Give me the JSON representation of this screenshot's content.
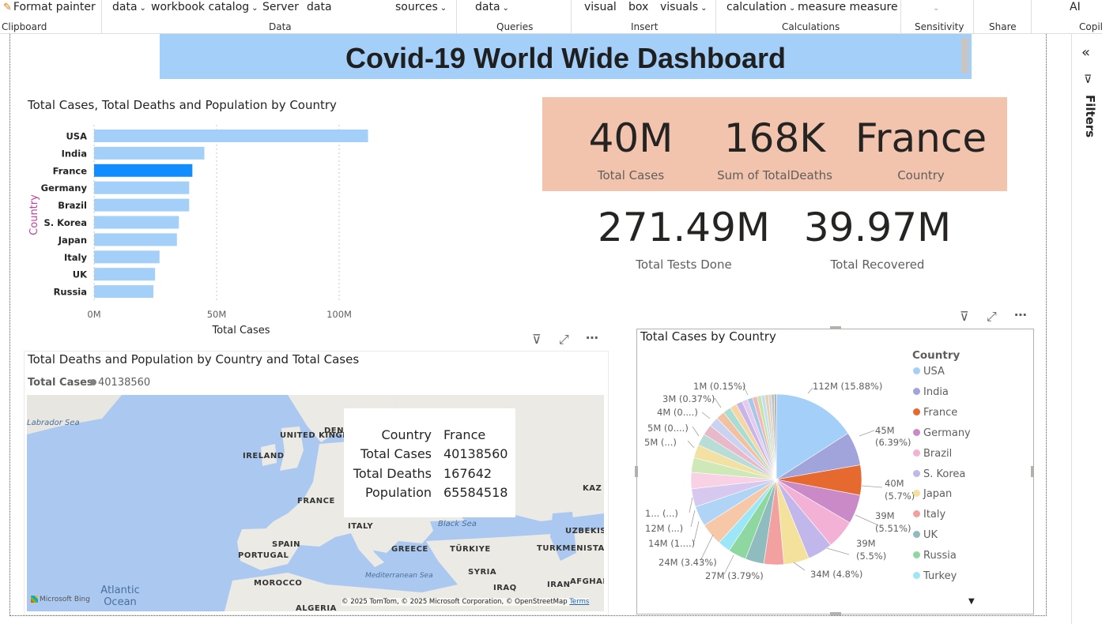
{
  "ribbon": {
    "items": [
      {
        "label": "Format painter"
      },
      {
        "label": "data"
      },
      {
        "label": "workbook catalog"
      },
      {
        "label": "Server"
      },
      {
        "label": "data"
      },
      {
        "label": "sources"
      },
      {
        "label": "data"
      },
      {
        "label": "visual"
      },
      {
        "label": "box"
      },
      {
        "label": "visuals"
      },
      {
        "label": "calculation"
      },
      {
        "label": "measure measure"
      },
      {
        "label": "AI"
      }
    ],
    "groups": [
      "Clipboard",
      "Data",
      "Queries",
      "Insert",
      "Calculations",
      "Sensitivity",
      "Share",
      "Copil"
    ]
  },
  "dashboard": {
    "title": "Covid-19 World Wide Dashboard"
  },
  "filters_pane": {
    "label": "Filters"
  },
  "bar_visual": {
    "title": "Total Cases, Total Deaths and Population by Country",
    "xlabel": "Total Cases",
    "ylabel": "Country",
    "ticks": [
      "0M",
      "50M",
      "100M"
    ]
  },
  "kpis": {
    "total_cases": {
      "value": "40M",
      "label": "Total Cases"
    },
    "total_deaths": {
      "value": "168K",
      "label": "Sum of TotalDeaths"
    },
    "country": {
      "value": "France",
      "label": "Country"
    },
    "tests": {
      "value": "271.49M",
      "label": "Total Tests Done"
    },
    "recovered": {
      "value": "39.97M",
      "label": "Total Recovered"
    }
  },
  "map_visual": {
    "title": "Total Deaths and Population by Country and Total Cases",
    "legend_title": "Total Cases",
    "legend_value": "40138560",
    "labels": [
      "Labrador Sea",
      "UNITED KINGDOM",
      "IRELAND",
      "DENM",
      "FRANCE",
      "SPAIN",
      "PORTUGAL",
      "MOROCCO",
      "ALGERIA",
      "ITALY",
      "GREECE",
      "TÜRKIYE",
      "SYRIA",
      "IRAQ",
      "IRAN",
      "AFGHAN",
      "KAZ",
      "UZBEKIST",
      "TURKMENISTAN",
      "Black Sea",
      "Mediterranean Sea",
      "Atlantic Ocean"
    ],
    "brand": "Microsoft Bing",
    "attribution": "© 2025 TomTom, © 2025 Microsoft Corporation, © OpenStreetMap",
    "terms": "Terms",
    "tooltip": [
      {
        "key": "Country",
        "value": "France"
      },
      {
        "key": "Total Cases",
        "value": "40138560"
      },
      {
        "key": "Total Deaths",
        "value": "167642"
      },
      {
        "key": "Population",
        "value": "65584518"
      }
    ]
  },
  "pie_visual": {
    "title": "Total Cases by Country",
    "legend_title": "Country",
    "data_labels": [
      "112M (15.88%)",
      "45M",
      "(6.39%)",
      "40M",
      "(5.7%)",
      "39M",
      "(5.51%)",
      "39M",
      "(5.5%)",
      "34M (4.8%)",
      "27M (3.79%)",
      "24M (3.43%)",
      "14M (1....)",
      "12M (...)",
      "1... (...)",
      "5M (...)",
      "5M (0....)",
      "4M (0....)",
      "3M (0.37%)",
      "1M (0.15%)"
    ]
  },
  "chart_data": [
    {
      "type": "bar",
      "title": "Total Cases, Total Deaths and Population by Country",
      "xlabel": "Total Cases",
      "ylabel": "Country",
      "categories": [
        "USA",
        "India",
        "France",
        "Germany",
        "Brazil",
        "S. Korea",
        "Japan",
        "Italy",
        "UK",
        "Russia"
      ],
      "values": [
        111.8,
        45.0,
        40.1,
        38.8,
        38.8,
        34.6,
        33.8,
        26.7,
        24.9,
        24.2
      ],
      "xlim": [
        0,
        120
      ],
      "unit": "M",
      "highlighted": "France",
      "colors": {
        "bar": "#a3cff9",
        "highlight": "#118dff"
      }
    },
    {
      "type": "pie",
      "title": "Total Cases by Country",
      "legend_title": "Country",
      "legend_position": "right",
      "categories": [
        "USA",
        "India",
        "France",
        "Germany",
        "Brazil",
        "S. Korea",
        "Japan",
        "Italy",
        "UK",
        "Russia",
        "Turkey"
      ],
      "values": [
        112,
        45,
        40,
        39,
        39,
        34,
        33.8,
        26.7,
        24.9,
        24.2,
        17
      ],
      "percents": [
        15.88,
        6.39,
        5.7,
        5.51,
        5.5,
        4.8,
        4.79,
        3.79,
        3.53,
        3.43,
        2.4
      ],
      "colors": [
        "#a3cff9",
        "#a0a4da",
        "#e6692f",
        "#c98ac7",
        "#f4b1d6",
        "#c1b7ea",
        "#f4e19c",
        "#f3a0a0",
        "#8fbcbe",
        "#8fd7a1",
        "#9de6f8"
      ],
      "other_total_percent": 38.33,
      "other_colors": [
        "#f7c8a8",
        "#b0d4f5",
        "#d7c8ef",
        "#f8d2e4",
        "#cfe8b7",
        "#f3e1a3",
        "#b8dcd6",
        "#e8b9c9",
        "#c9d2f0",
        "#f1c1a1",
        "#a9ddd1",
        "#f6d6a7",
        "#c6b5e8",
        "#e3ccee",
        "#a8c6e8",
        "#f0b8b8",
        "#cbe3a8",
        "#bde0f7",
        "#e9d0a9",
        "#d4d4d4",
        "#c0c0c0",
        "#b5b5b5"
      ]
    }
  ]
}
